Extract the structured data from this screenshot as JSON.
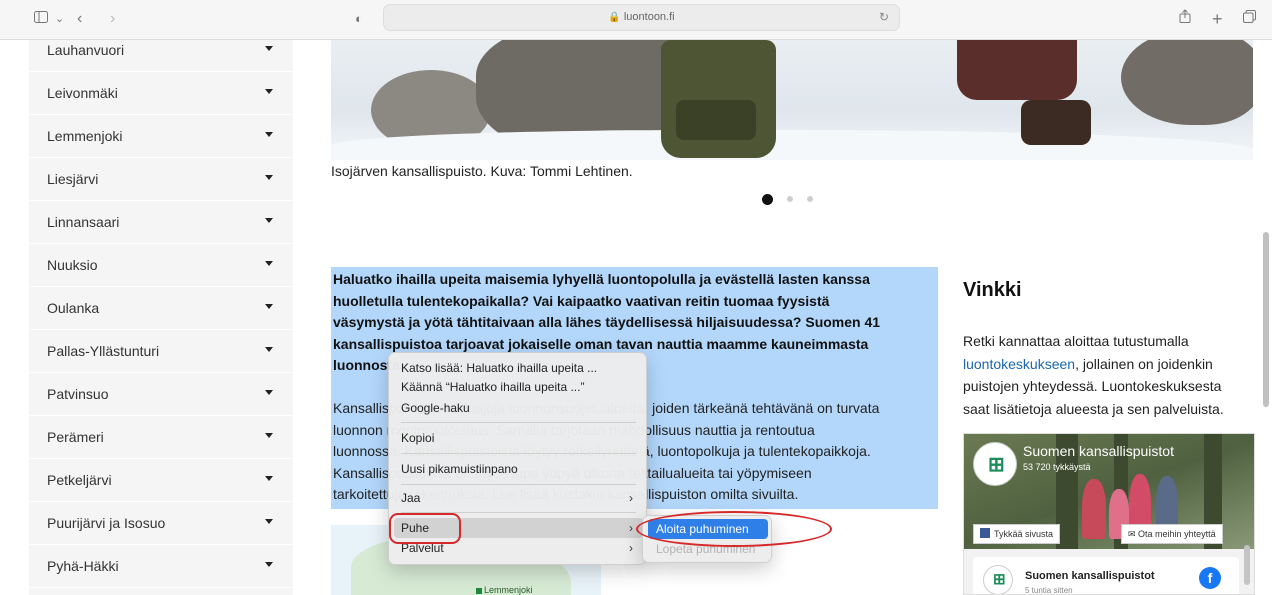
{
  "browser": {
    "url": "luontoon.fi",
    "icons": [
      "sidebar-icon",
      "chevron-down-icon",
      "back-icon",
      "forward-icon",
      "privacy-shield-icon",
      "lock-icon",
      "reload-icon",
      "share-icon",
      "new-tab-icon",
      "tabs-overview-icon"
    ]
  },
  "sidebar": {
    "items": [
      {
        "label": "Lauhanvuori"
      },
      {
        "label": "Leivonmäki"
      },
      {
        "label": "Lemmenjoki"
      },
      {
        "label": "Liesjärvi"
      },
      {
        "label": "Linnansaari"
      },
      {
        "label": "Nuuksio"
      },
      {
        "label": "Oulanka"
      },
      {
        "label": "Pallas-Yllästunturi"
      },
      {
        "label": "Patvinsuo"
      },
      {
        "label": "Perämeri"
      },
      {
        "label": "Petkeljärvi"
      },
      {
        "label": "Puurijärvi ja Isosuo"
      },
      {
        "label": "Pyhä-Häkki"
      }
    ]
  },
  "hero": {
    "caption": "Isojärven kansallispuisto. Kuva: Tommi Lehtinen.",
    "slide_count": 3,
    "active_slide": 1
  },
  "article": {
    "lead_lines": [
      "Haluatko ihailla upeita maisemia lyhyellä luontopolulla ja evästellä lasten kanssa",
      "huolletulla tulentekopaikalla? Vai kaipaatko vaativan reitin tuomaa fyysistä",
      "väsymystä ja yötä tähtitaivaan alla lähes täydellisessä hiljaisuudessa? Suomen 41",
      "kansallispuistoa tarjoavat jokaiselle oman tavan nauttia maamme kauneimmasta",
      "luonnosta."
    ],
    "body_lines": [
      "Kansallispuistot ovat laajoja luonnonsuojelualueita, joiden tärkeänä tehtävänä on turvata",
      "luonnon monimuotoisuus. Samalla tarjotaan mahdollisuus nauttia ja rentoutua",
      "luonnossa. Kansallispuistoista löytyy retkeilyreittejä, luontopolkuja ja tulentekopaikkoja.",
      "Kansallispuistoissa on myös lupa yöpyä ulkona telttailualueita tai yöpymiseen",
      "tarkoitettuja rakennuksia. Lue lisää kustakin kansallispuiston omilta sivuilta."
    ]
  },
  "map": {
    "label": "Lemmenjoki"
  },
  "tip": {
    "title": "Vinkki",
    "line1": "Retki kannattaa aloittaa tutustumalla",
    "link": "luontokeskukseen",
    "line2_rest": ", jollainen on joidenkin",
    "line3": "puistojen yhteydessä. Luontokeskuksesta",
    "line4": "saat lisätietoja alueesta ja sen palveluista."
  },
  "facebook": {
    "page_name": "Suomen kansallispuistot",
    "likes": "53 720 tykkäystä",
    "like_button": "Tykkää sivusta",
    "contact_button": "Ota meihin yhteyttä",
    "post_author": "Suomen kansallispuistot",
    "post_time": "5 tuntia sitten",
    "brand_color": "#1877f2"
  },
  "context_menu": {
    "items": [
      {
        "label": "Katso lisää: Haluatko ihailla upeita ...",
        "submenu": false
      },
      {
        "label": "Käännä “Haluatko ihailla upeita ...”",
        "submenu": false
      },
      {
        "label": "Google-haku",
        "submenu": false
      },
      {
        "label": "Kopioi",
        "submenu": false
      },
      {
        "label": "Uusi pikamuistiinpano",
        "submenu": false
      },
      {
        "label": "Jaa",
        "submenu": true
      },
      {
        "label": "Puhe",
        "submenu": true,
        "highlighted": true
      },
      {
        "label": "Palvelut",
        "submenu": true
      }
    ],
    "speech_submenu": [
      {
        "label": "Aloita puhuminen",
        "active": true
      },
      {
        "label": "Lopeta puhuminen",
        "disabled": true
      }
    ],
    "arrow_glyph": "›"
  },
  "colors": {
    "selection": "#b3d7fb",
    "link": "#1a66b0",
    "menu_active": "#2f7fe9",
    "annotation": "#d62a2a"
  }
}
